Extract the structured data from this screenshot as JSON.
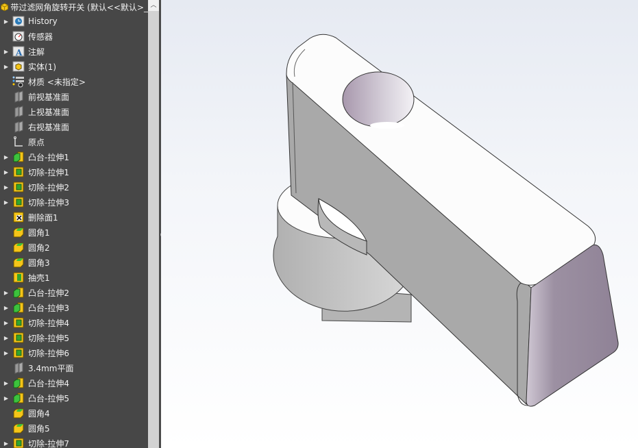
{
  "tree": {
    "title": "带过滤网角旋转开关  (默认<<默认>_",
    "items": [
      {
        "label": "History",
        "icon": "history-icon",
        "expandable": true
      },
      {
        "label": "传感器",
        "icon": "sensor-icon",
        "expandable": false
      },
      {
        "label": "注解",
        "icon": "annotation-icon",
        "expandable": true
      },
      {
        "label": "实体(1)",
        "icon": "solid-bodies-icon",
        "expandable": true
      },
      {
        "label": "材质 <未指定>",
        "icon": "material-icon",
        "expandable": false
      },
      {
        "label": "前视基准面",
        "icon": "plane-icon",
        "expandable": false
      },
      {
        "label": "上视基准面",
        "icon": "plane-icon",
        "expandable": false
      },
      {
        "label": "右视基准面",
        "icon": "plane-icon",
        "expandable": false
      },
      {
        "label": "原点",
        "icon": "origin-icon",
        "expandable": false
      },
      {
        "label": "凸台-拉伸1",
        "icon": "boss-extrude-icon",
        "expandable": true
      },
      {
        "label": "切除-拉伸1",
        "icon": "cut-extrude-icon",
        "expandable": true
      },
      {
        "label": "切除-拉伸2",
        "icon": "cut-extrude-icon",
        "expandable": true
      },
      {
        "label": "切除-拉伸3",
        "icon": "cut-extrude-icon",
        "expandable": true
      },
      {
        "label": "删除面1",
        "icon": "delete-face-icon",
        "expandable": false
      },
      {
        "label": "圆角1",
        "icon": "fillet-icon",
        "expandable": false
      },
      {
        "label": "圆角2",
        "icon": "fillet-icon",
        "expandable": false
      },
      {
        "label": "圆角3",
        "icon": "fillet-icon",
        "expandable": false
      },
      {
        "label": "抽壳1",
        "icon": "shell-icon",
        "expandable": false
      },
      {
        "label": "凸台-拉伸2",
        "icon": "boss-extrude-icon",
        "expandable": true
      },
      {
        "label": "凸台-拉伸3",
        "icon": "boss-extrude-icon",
        "expandable": true
      },
      {
        "label": "切除-拉伸4",
        "icon": "cut-extrude-icon",
        "expandable": true
      },
      {
        "label": "切除-拉伸5",
        "icon": "cut-extrude-icon",
        "expandable": true
      },
      {
        "label": "切除-拉伸6",
        "icon": "cut-extrude-icon",
        "expandable": true
      },
      {
        "label": "3.4mm平面",
        "icon": "plane-icon",
        "expandable": false
      },
      {
        "label": "凸台-拉伸4",
        "icon": "boss-extrude-icon",
        "expandable": true
      },
      {
        "label": "凸台-拉伸5",
        "icon": "boss-extrude-icon",
        "expandable": true
      },
      {
        "label": "圆角4",
        "icon": "fillet-icon",
        "expandable": false
      },
      {
        "label": "圆角5",
        "icon": "fillet-icon",
        "expandable": false
      },
      {
        "label": "切除-拉伸7",
        "icon": "cut-extrude-icon",
        "expandable": true
      }
    ]
  },
  "colors": {
    "panel": "#474747",
    "top_face": "#ffffff",
    "front_face": "#a9a9a9",
    "end_face": "#9c90a2"
  }
}
